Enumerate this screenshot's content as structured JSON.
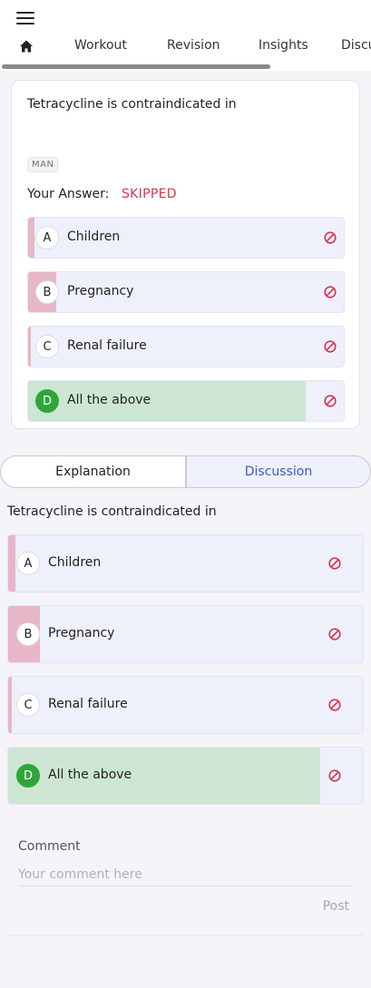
{
  "nav": {
    "tabs": [
      {
        "label": "Workout"
      },
      {
        "label": "Revision"
      },
      {
        "label": "Insights"
      },
      {
        "label": "Discu"
      }
    ]
  },
  "question": {
    "text": "Tetracycline is contraindicated in",
    "tag": "MAN",
    "your_answer_label": "Your Answer:",
    "your_answer_value": "SKIPPED",
    "options": [
      {
        "letter": "A",
        "label": "Children",
        "percent": 2,
        "correct": false
      },
      {
        "letter": "B",
        "label": "Pregnancy",
        "percent": 9,
        "correct": false
      },
      {
        "letter": "C",
        "label": "Renal failure",
        "percent": 1,
        "correct": false
      },
      {
        "letter": "D",
        "label": "All the above",
        "percent": 88,
        "correct": true
      }
    ]
  },
  "detail_tabs": {
    "explanation": "Explanation",
    "discussion": "Discussion"
  },
  "comment": {
    "label": "Comment",
    "placeholder": "Your comment here",
    "value": "",
    "post_label": "Post"
  },
  "colors": {
    "incorrect_fill": "#e8b6c7",
    "correct_fill": "#cde6d3",
    "correct_badge": "#2fa63c",
    "skipped": "#d9364f",
    "accent": "#3a5bc7"
  },
  "icons": {
    "menu": "menu-icon",
    "home": "home-icon",
    "option_status": "ban-icon"
  }
}
